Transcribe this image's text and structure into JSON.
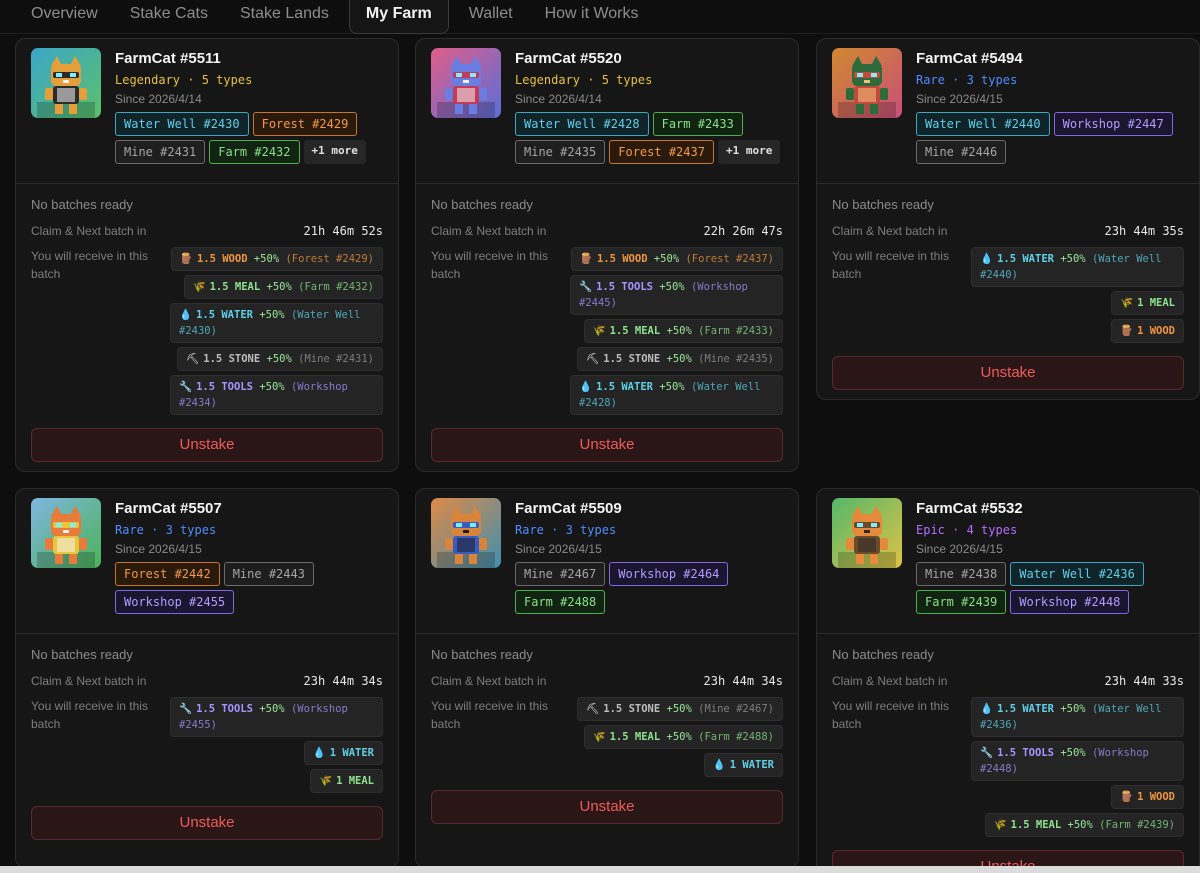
{
  "tabs": [
    {
      "label": "Overview"
    },
    {
      "label": "Stake Cats"
    },
    {
      "label": "Stake Lands"
    },
    {
      "label": "My Farm",
      "active": true
    },
    {
      "label": "Wallet"
    },
    {
      "label": "How it Works"
    }
  ],
  "labels": {
    "no_batches": "No batches ready",
    "claim_next": "Claim & Next batch in",
    "receive": "You will receive in this batch",
    "unstake": "Unstake"
  },
  "colors": {
    "legendary": "#e9c23a",
    "rare": "#4f8cff",
    "epic": "#b46cff",
    "unstake": "#ef5b5b"
  },
  "cards": [
    {
      "name": "FarmCat #5511",
      "rarity": "Legendary",
      "types": "5 types",
      "since": "Since 2026/4/14",
      "chips": [
        {
          "label": "Water Well #2430",
          "kind": "water"
        },
        {
          "label": "Forest #2429",
          "kind": "forest"
        },
        {
          "label": "Mine #2431",
          "kind": "mine"
        },
        {
          "label": "Farm #2432",
          "kind": "farm"
        },
        {
          "label": "+1 more",
          "kind": "more"
        }
      ],
      "countdown": "21h 46m 52s",
      "rewards": [
        {
          "icon": "wood-icon",
          "glyph": "🪵",
          "kind": "wood",
          "amount": "1.5 WOOD",
          "boost": "+50%",
          "source": "(Forest #2429)"
        },
        {
          "icon": "meal-icon",
          "glyph": "🌾",
          "kind": "meal",
          "amount": "1.5 MEAL",
          "boost": "+50%",
          "source": "(Farm #2432)"
        },
        {
          "icon": "water-icon",
          "glyph": "💧",
          "kind": "water",
          "amount": "1.5 WATER",
          "boost": "+50%",
          "source": "(Water Well #2430)"
        },
        {
          "icon": "stone-icon",
          "glyph": "⛏",
          "kind": "stone",
          "amount": "1.5 STONE",
          "boost": "+50%",
          "source": "(Mine #2431)"
        },
        {
          "icon": "tools-icon",
          "glyph": "🔧",
          "kind": "tools",
          "amount": "1.5 TOOLS",
          "boost": "+50%",
          "source": "(Workshop #2434)"
        }
      ]
    },
    {
      "name": "FarmCat #5520",
      "rarity": "Legendary",
      "types": "5 types",
      "since": "Since 2026/4/14",
      "chips": [
        {
          "label": "Water Well #2428",
          "kind": "water"
        },
        {
          "label": "Farm #2433",
          "kind": "farm"
        },
        {
          "label": "Mine #2435",
          "kind": "mine"
        },
        {
          "label": "Forest #2437",
          "kind": "forest"
        },
        {
          "label": "+1 more",
          "kind": "more"
        }
      ],
      "countdown": "22h 26m 47s",
      "rewards": [
        {
          "icon": "wood-icon",
          "glyph": "🪵",
          "kind": "wood",
          "amount": "1.5 WOOD",
          "boost": "+50%",
          "source": "(Forest #2437)"
        },
        {
          "icon": "tools-icon",
          "glyph": "🔧",
          "kind": "tools",
          "amount": "1.5 TOOLS",
          "boost": "+50%",
          "source": "(Workshop #2445)"
        },
        {
          "icon": "meal-icon",
          "glyph": "🌾",
          "kind": "meal",
          "amount": "1.5 MEAL",
          "boost": "+50%",
          "source": "(Farm #2433)"
        },
        {
          "icon": "stone-icon",
          "glyph": "⛏",
          "kind": "stone",
          "amount": "1.5 STONE",
          "boost": "+50%",
          "source": "(Mine #2435)"
        },
        {
          "icon": "water-icon",
          "glyph": "💧",
          "kind": "water",
          "amount": "1.5 WATER",
          "boost": "+50%",
          "source": "(Water Well #2428)"
        }
      ]
    },
    {
      "name": "FarmCat #5494",
      "rarity": "Rare",
      "types": "3 types",
      "since": "Since 2026/4/15",
      "chips": [
        {
          "label": "Water Well #2440",
          "kind": "water"
        },
        {
          "label": "Workshop #2447",
          "kind": "workshop"
        },
        {
          "label": "Mine #2446",
          "kind": "mine"
        }
      ],
      "countdown": "23h 44m 35s",
      "rewards": [
        {
          "icon": "water-icon",
          "glyph": "💧",
          "kind": "water",
          "amount": "1.5 WATER",
          "boost": "+50%",
          "source": "(Water Well #2440)"
        },
        {
          "icon": "meal-icon",
          "glyph": "🌾",
          "kind": "meal",
          "amount": "1 MEAL",
          "boost": "",
          "source": ""
        },
        {
          "icon": "wood-icon",
          "glyph": "🪵",
          "kind": "wood",
          "amount": "1 WOOD",
          "boost": "",
          "source": ""
        }
      ]
    },
    {
      "name": "FarmCat #5507",
      "rarity": "Rare",
      "types": "3 types",
      "since": "Since 2026/4/15",
      "chips": [
        {
          "label": "Forest #2442",
          "kind": "forest"
        },
        {
          "label": "Mine #2443",
          "kind": "mine"
        },
        {
          "label": "Workshop #2455",
          "kind": "workshop"
        }
      ],
      "countdown": "23h 44m 34s",
      "rewards": [
        {
          "icon": "tools-icon",
          "glyph": "🔧",
          "kind": "tools",
          "amount": "1.5 TOOLS",
          "boost": "+50%",
          "source": "(Workshop #2455)"
        },
        {
          "icon": "water-icon",
          "glyph": "💧",
          "kind": "water",
          "amount": "1 WATER",
          "boost": "",
          "source": ""
        },
        {
          "icon": "meal-icon",
          "glyph": "🌾",
          "kind": "meal",
          "amount": "1 MEAL",
          "boost": "",
          "source": ""
        }
      ]
    },
    {
      "name": "FarmCat #5509",
      "rarity": "Rare",
      "types": "3 types",
      "since": "Since 2026/4/15",
      "chips": [
        {
          "label": "Mine #2467",
          "kind": "mine"
        },
        {
          "label": "Workshop #2464",
          "kind": "workshop"
        },
        {
          "label": "Farm #2488",
          "kind": "farm"
        }
      ],
      "countdown": "23h 44m 34s",
      "rewards": [
        {
          "icon": "stone-icon",
          "glyph": "⛏",
          "kind": "stone",
          "amount": "1.5 STONE",
          "boost": "+50%",
          "source": "(Mine #2467)"
        },
        {
          "icon": "meal-icon",
          "glyph": "🌾",
          "kind": "meal",
          "amount": "1.5 MEAL",
          "boost": "+50%",
          "source": "(Farm #2488)"
        },
        {
          "icon": "water-icon",
          "glyph": "💧",
          "kind": "water",
          "amount": "1 WATER",
          "boost": "",
          "source": ""
        }
      ]
    },
    {
      "name": "FarmCat #5532",
      "rarity": "Epic",
      "types": "4 types",
      "since": "Since 2026/4/15",
      "chips": [
        {
          "label": "Mine #2438",
          "kind": "mine"
        },
        {
          "label": "Water Well #2436",
          "kind": "water"
        },
        {
          "label": "Farm #2439",
          "kind": "farm"
        },
        {
          "label": "Workshop #2448",
          "kind": "workshop"
        }
      ],
      "countdown": "23h 44m 33s",
      "rewards": [
        {
          "icon": "water-icon",
          "glyph": "💧",
          "kind": "water",
          "amount": "1.5 WATER",
          "boost": "+50%",
          "source": "(Water Well #2436)"
        },
        {
          "icon": "tools-icon",
          "glyph": "🔧",
          "kind": "tools",
          "amount": "1.5 TOOLS",
          "boost": "+50%",
          "source": "(Workshop #2448)"
        },
        {
          "icon": "wood-icon",
          "glyph": "🪵",
          "kind": "wood",
          "amount": "1 WOOD",
          "boost": "",
          "source": ""
        },
        {
          "icon": "meal-icon",
          "glyph": "🌾",
          "kind": "meal",
          "amount": "1.5 MEAL",
          "boost": "+50%",
          "source": "(Farm #2439)"
        }
      ]
    }
  ]
}
